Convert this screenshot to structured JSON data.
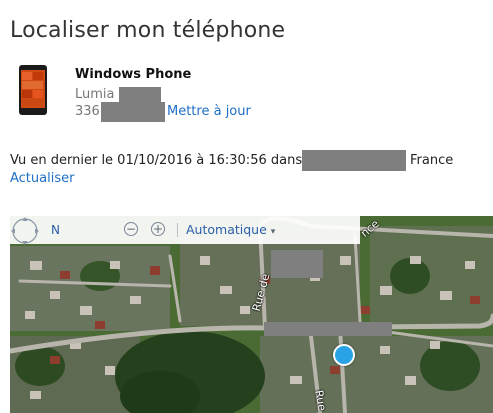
{
  "page": {
    "title": "Localiser mon téléphone"
  },
  "device": {
    "name": "Windows Phone",
    "model_prefix": "Lumia",
    "number_prefix": "336",
    "update_label": "Mettre à jour"
  },
  "status": {
    "last_seen_text": "Vu en dernier le 01/10/2016 à 16:30:56 dans",
    "country": "France",
    "refresh_label": "Actualiser"
  },
  "map": {
    "compass_label": "N",
    "zoom_out_symbol": "−",
    "zoom_in_symbol": "+",
    "mode_label": "Automatique",
    "mode_arrow": "▾",
    "street_label_1": "Rue de",
    "street_label_2": "Rue",
    "street_label_3": "nce",
    "dot_color": "#29a3e6"
  },
  "icons": {
    "device": "phone-icon",
    "compass": "compass-icon",
    "zoom_out": "zoom-out-icon",
    "zoom_in": "zoom-in-icon",
    "location": "location-dot-icon"
  }
}
